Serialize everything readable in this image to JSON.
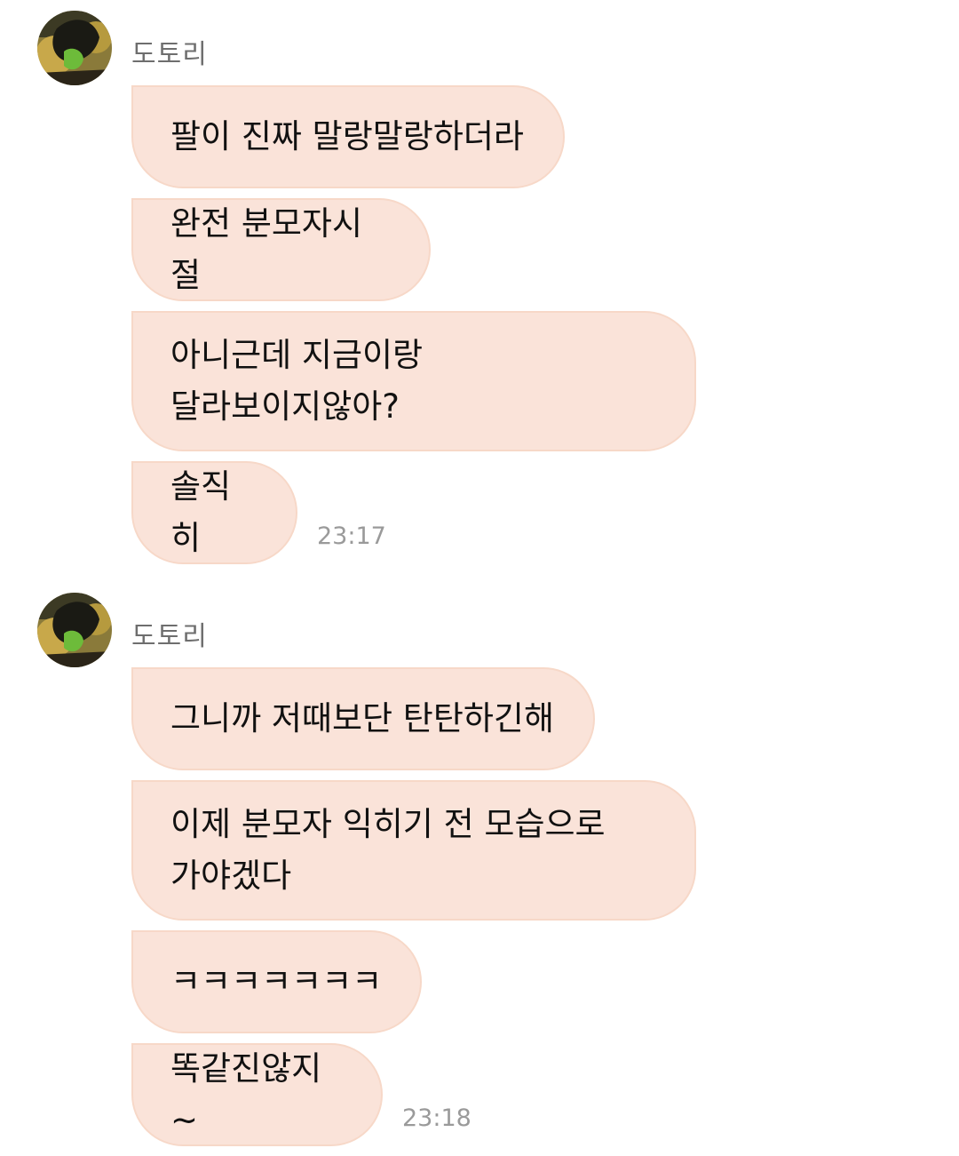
{
  "chat": {
    "groups": [
      {
        "sender": "도토리",
        "avatar_icon": "profile-photo-avatar",
        "messages": [
          "팔이 진짜 말랑말랑하더라",
          "완전 분모자시절",
          "아니근데 지금이랑\n달라보이지않아?",
          "솔직히"
        ],
        "time": "23:17"
      },
      {
        "sender": "도토리",
        "avatar_icon": "profile-photo-avatar",
        "messages": [
          "그니까 저때보단 탄탄하긴해",
          "이제 분모자 익히기 전 모습으로\n가야겠다",
          "ㅋㅋㅋㅋㅋㅋㅋ",
          "똑같진않지~"
        ],
        "time": "23:18"
      }
    ]
  },
  "colors": {
    "bubble_bg": "#fae3d9",
    "bubble_border": "#f7d8c8",
    "sender_text": "#6e6e6e",
    "time_text": "#9a9a9a"
  }
}
